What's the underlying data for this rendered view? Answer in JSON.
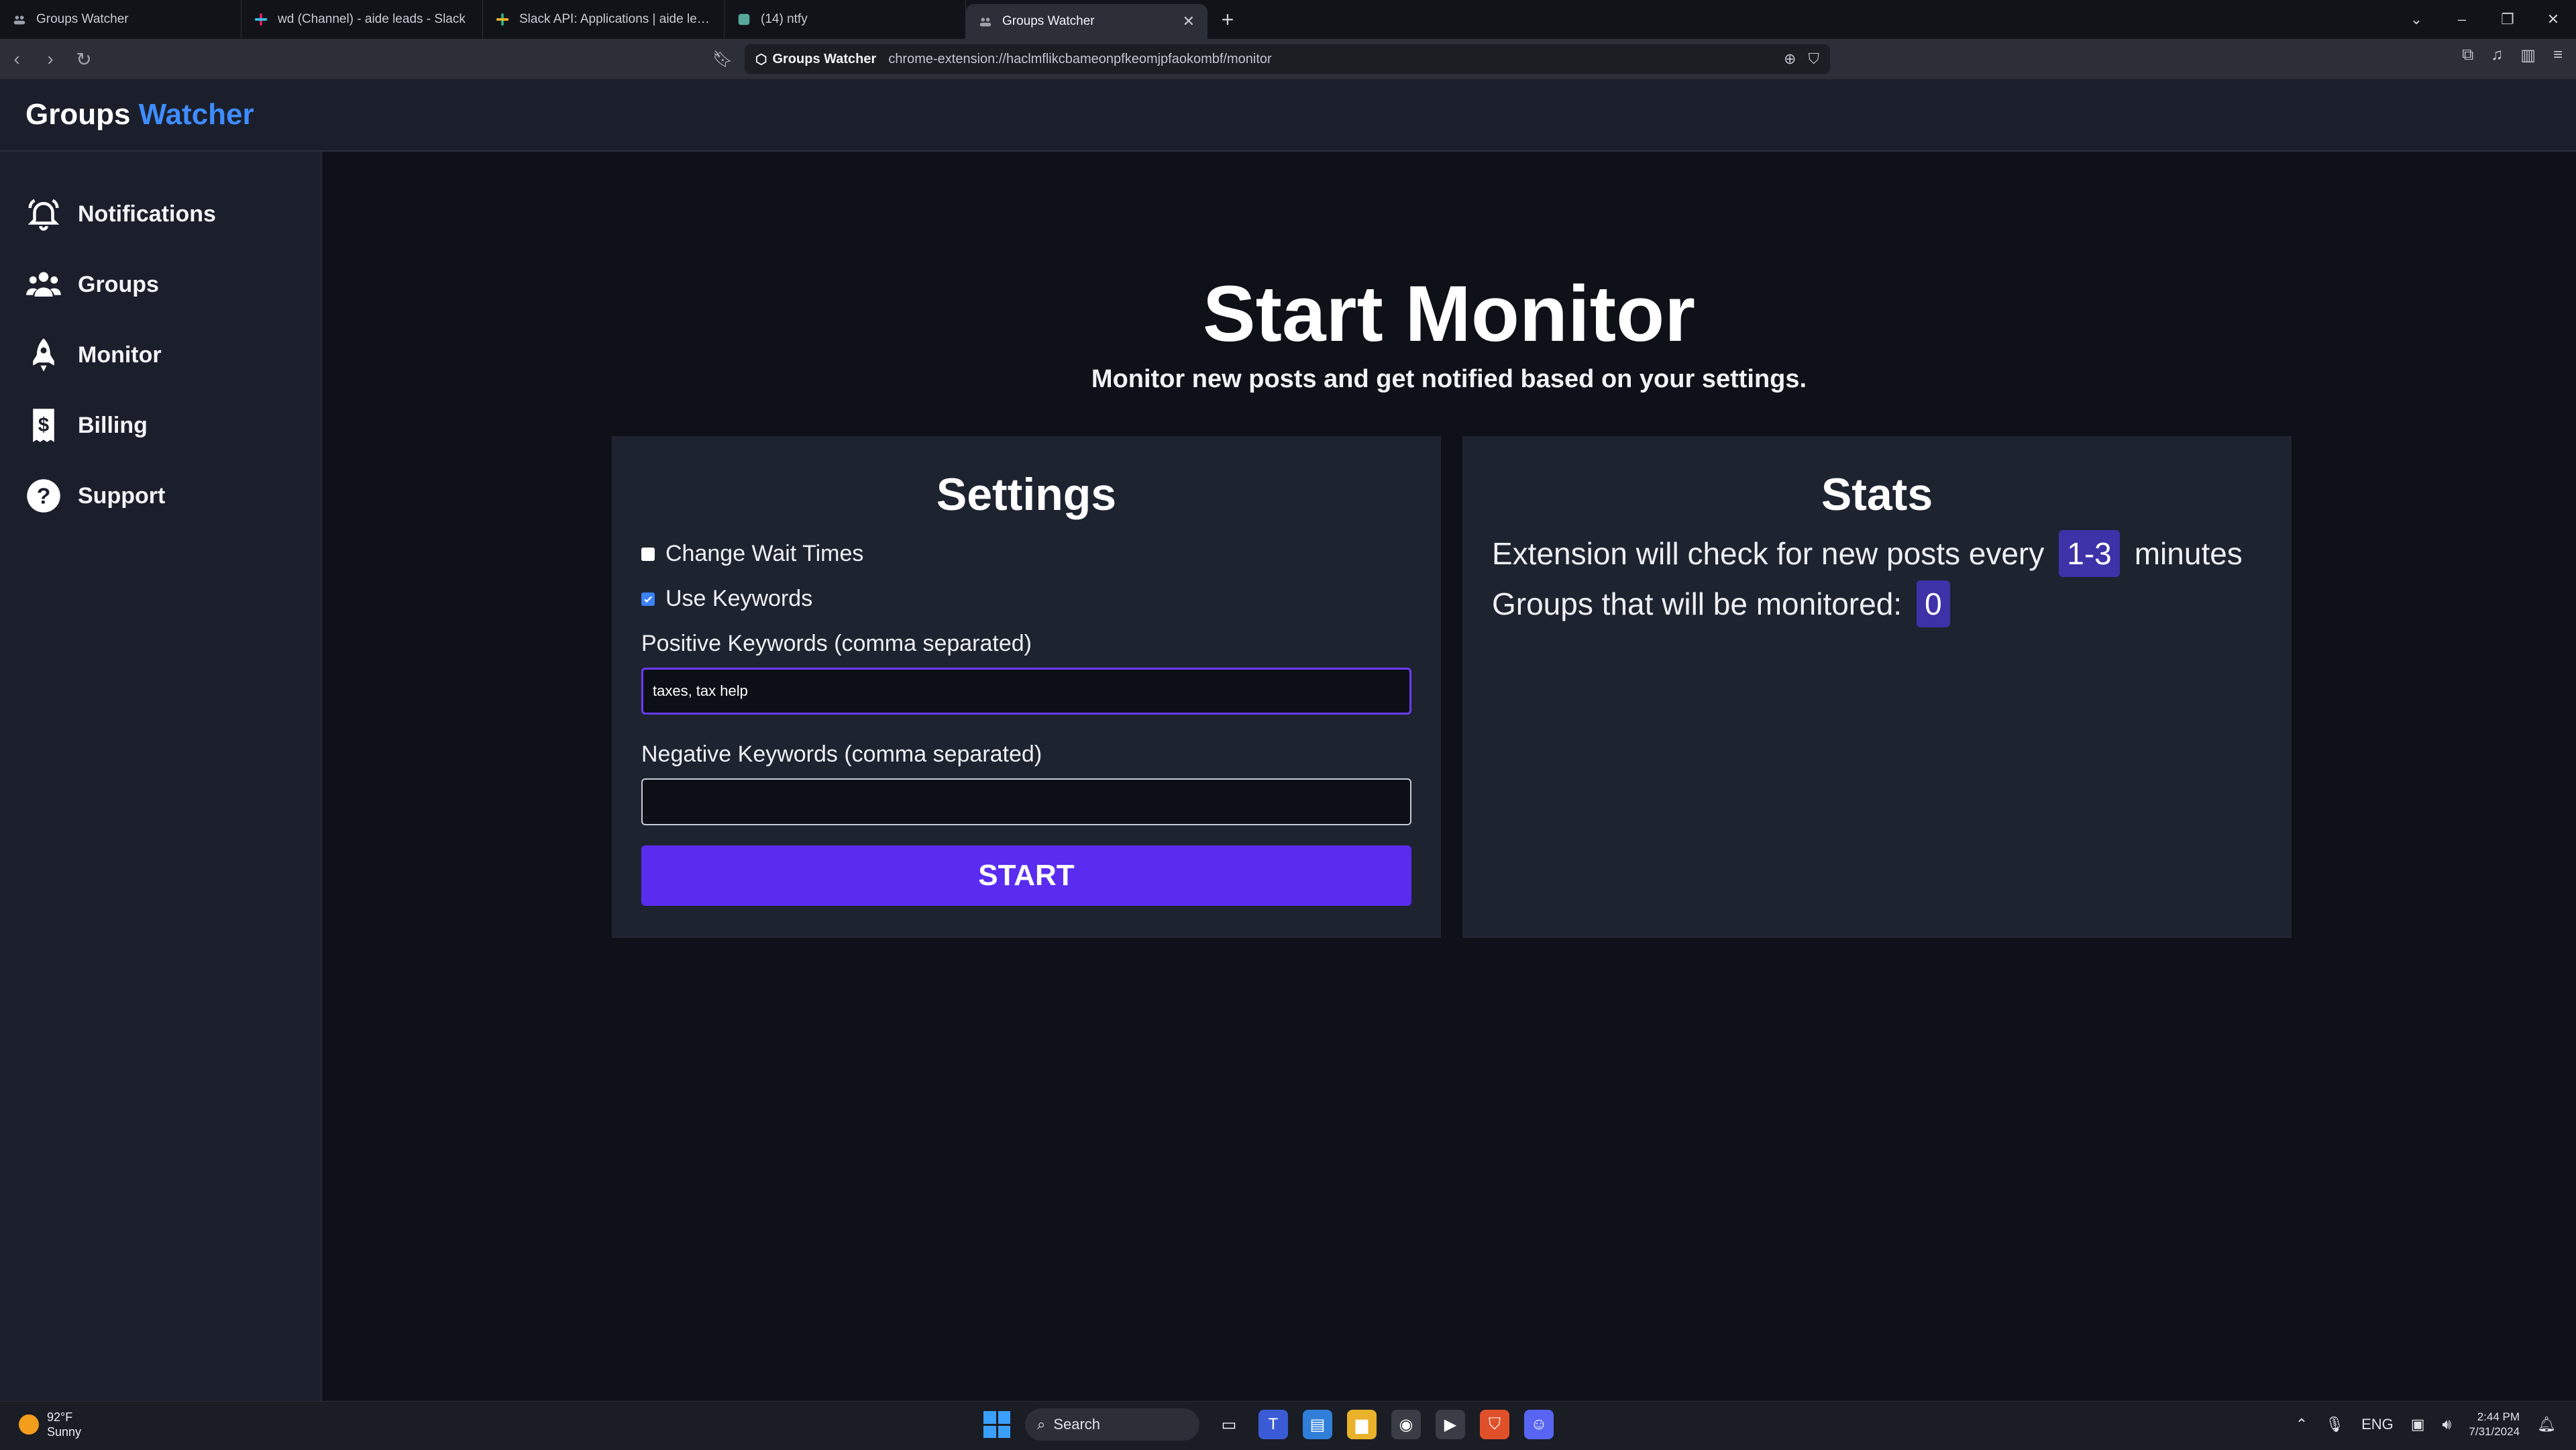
{
  "browser": {
    "tabs": [
      {
        "title": "Groups Watcher",
        "active": false
      },
      {
        "title": "wd (Channel) - aide leads - Slack",
        "active": false
      },
      {
        "title": "Slack API: Applications | aide leads",
        "active": false
      },
      {
        "title": "(14) ntfy",
        "active": false
      },
      {
        "title": "Groups Watcher",
        "active": true
      }
    ],
    "site_name": "Groups Watcher",
    "url": "chrome-extension://haclmflikcbameonpfkeomjpfaokombf/monitor"
  },
  "brand": {
    "part1": "Groups",
    "part2": "Watcher",
    "accent_color": "#3f8cff"
  },
  "sidebar": {
    "items": [
      {
        "label": "Notifications",
        "icon": "bell-icon"
      },
      {
        "label": "Groups",
        "icon": "users-icon"
      },
      {
        "label": "Monitor",
        "icon": "rocket-icon"
      },
      {
        "label": "Billing",
        "icon": "dollar-receipt-icon"
      },
      {
        "label": "Support",
        "icon": "question-circle-icon"
      }
    ]
  },
  "main": {
    "title": "Start Monitor",
    "subtitle": "Monitor new posts and get notified based on your settings."
  },
  "settings": {
    "title": "Settings",
    "change_wait_times_label": "Change Wait Times",
    "change_wait_times_checked": false,
    "use_keywords_label": "Use Keywords",
    "use_keywords_checked": true,
    "positive_label": "Positive Keywords (comma separated)",
    "positive_value": "taxes, tax help",
    "negative_label": "Negative Keywords (comma separated)",
    "negative_value": "",
    "start_label": "START",
    "start_color": "#5a2cf0"
  },
  "stats": {
    "title": "Stats",
    "check_prefix": "Extension will check for new posts every",
    "check_value": "1-3",
    "check_suffix": "minutes",
    "groups_prefix": "Groups that will be monitored:",
    "groups_value": "0"
  },
  "taskbar": {
    "temperature": "92°F",
    "weather": "Sunny",
    "search_label": "Search",
    "language": "ENG",
    "time": "2:44 PM",
    "date": "7/31/2024"
  }
}
